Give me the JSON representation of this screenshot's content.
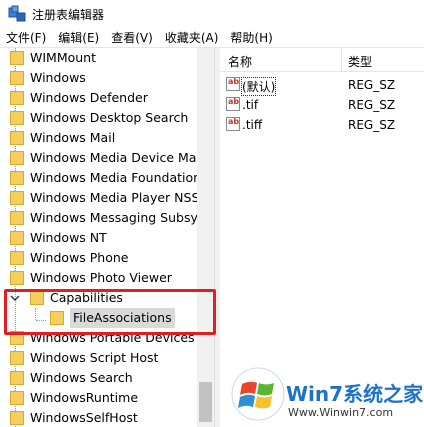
{
  "window": {
    "title": "注册表编辑器"
  },
  "menu": [
    "文件(F)",
    "编辑(E)",
    "查看(V)",
    "收藏夹(A)",
    "帮助(H)"
  ],
  "tree": {
    "items": [
      "WIMMount",
      "Windows",
      "Windows Defender",
      "Windows Desktop Search",
      "Windows Mail",
      "Windows Media Device Mana",
      "Windows Media Foundation",
      "Windows Media Player NSS",
      "Windows Messaging Subsyst",
      "Windows NT",
      "Windows Phone",
      "Windows Photo Viewer",
      "Capabilities",
      "FileAssociations",
      "Windows Portable Devices",
      "Windows Script Host",
      "Windows Search",
      "WindowsRuntime",
      "WindowsSelfHost"
    ],
    "selected": "FileAssociations",
    "expanded": "Capabilities"
  },
  "list": {
    "columns": [
      "名称",
      "类型"
    ],
    "rows": [
      {
        "name": "(默认)",
        "type": "REG_SZ"
      },
      {
        "name": ".tif",
        "type": "REG_SZ"
      },
      {
        "name": ".tiff",
        "type": "REG_SZ"
      }
    ],
    "icon_text": "ab"
  },
  "watermark": {
    "brand": "Win7系统之家",
    "url": "Www.Winwin7.com"
  },
  "colors": {
    "folder": "#f5cf5d",
    "folder_edge": "#d9a92a",
    "highlight": "#e02020",
    "selection": "#d9d9d9",
    "watermark_blue": "#1e72c8"
  }
}
